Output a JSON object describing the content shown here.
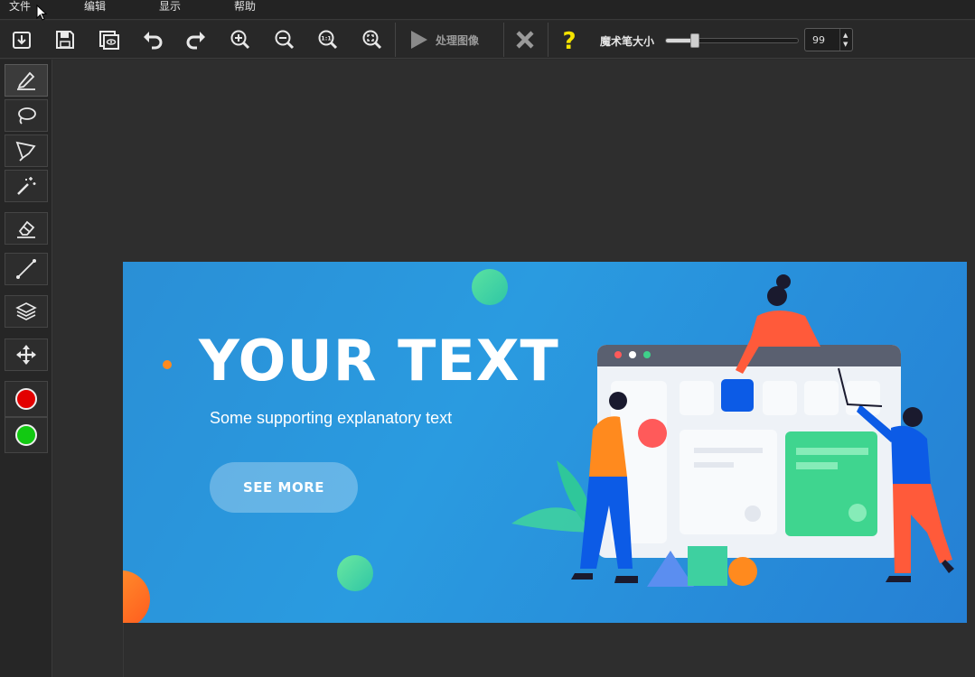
{
  "menu": [
    "文件",
    "编辑",
    "显示",
    "帮助"
  ],
  "toolbar": {
    "buttons": [
      {
        "name": "import-icon"
      },
      {
        "name": "save-icon"
      },
      {
        "name": "preview-icon"
      },
      {
        "name": "undo-icon"
      },
      {
        "name": "redo-icon"
      },
      {
        "name": "zoom-in-icon"
      },
      {
        "name": "zoom-out-icon"
      },
      {
        "name": "zoom-actual-icon"
      },
      {
        "name": "zoom-fit-icon"
      }
    ],
    "process_label": "处理图像",
    "brush_size_label": "魔术笔大小",
    "brush_size_value": "99",
    "brush_size_fraction": 0.22
  },
  "tools": [
    {
      "name": "pen-tool"
    },
    {
      "name": "lasso-tool"
    },
    {
      "name": "polygon-lasso-tool"
    },
    {
      "name": "magic-wand-tool"
    },
    {
      "name": "eraser-tool"
    },
    {
      "name": "line-tool"
    },
    {
      "name": "layers-tool"
    },
    {
      "name": "move-tool"
    }
  ],
  "colors": {
    "foreground": "#e30000",
    "background": "#12c912",
    "help": "#f5e400"
  },
  "banner": {
    "title": "YOUR TEXT",
    "subtitle": "Some supporting explanatory text",
    "button": "SEE MORE"
  }
}
